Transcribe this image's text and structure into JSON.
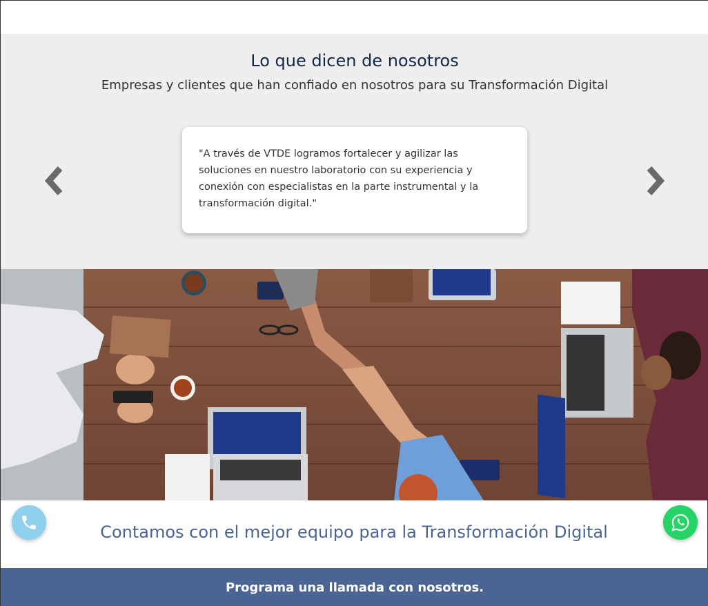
{
  "testimonials": {
    "title": "Lo que dicen de nosotros",
    "subtitle": "Empresas y clientes que han confiado en nosotros para su Transformación Digital",
    "quote": "\"A través de VTDE logramos fortalecer y agilizar las soluciones en nuestro laboratorio con su experiencia y conexión con especialistas en la parte instrumental y la transformación digital.\"",
    "prev_icon": "chevron-left-icon",
    "next_icon": "chevron-right-icon"
  },
  "team": {
    "title": "Contamos con el mejor equipo para la Transformación Digital"
  },
  "floating": {
    "call_icon": "phone-icon",
    "whatsapp_icon": "whatsapp-icon"
  },
  "cta": {
    "label": "Programa una llamada con nosotros."
  },
  "colors": {
    "section_bg": "#eeeeee",
    "heading_dark": "#14264a",
    "accent_blue": "#4a6594",
    "call_button": "#8fd0ee",
    "whatsapp_green": "#25d366"
  }
}
